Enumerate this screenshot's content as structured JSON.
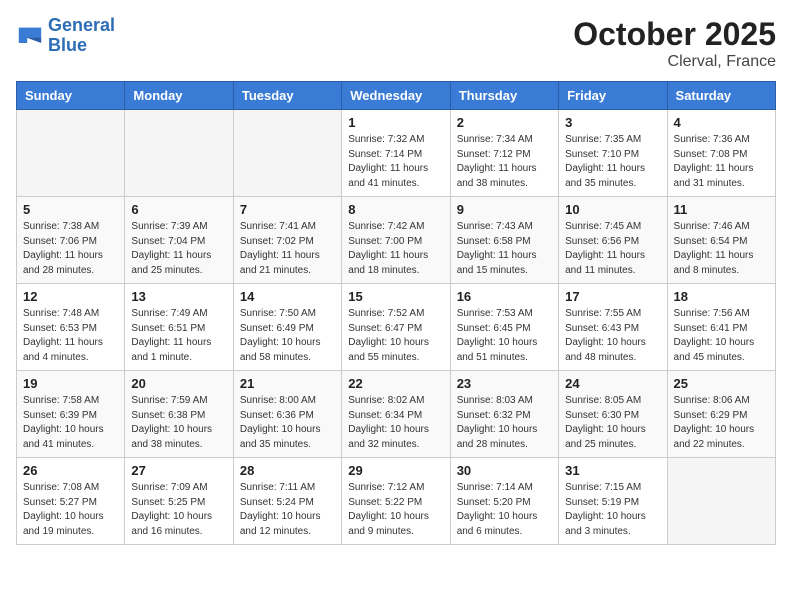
{
  "logo": {
    "line1": "General",
    "line2": "Blue"
  },
  "title": "October 2025",
  "location": "Clerval, France",
  "days_header": [
    "Sunday",
    "Monday",
    "Tuesday",
    "Wednesday",
    "Thursday",
    "Friday",
    "Saturday"
  ],
  "weeks": [
    [
      {
        "day": "",
        "sunrise": "",
        "sunset": "",
        "daylight": ""
      },
      {
        "day": "",
        "sunrise": "",
        "sunset": "",
        "daylight": ""
      },
      {
        "day": "",
        "sunrise": "",
        "sunset": "",
        "daylight": ""
      },
      {
        "day": "1",
        "sunrise": "Sunrise: 7:32 AM",
        "sunset": "Sunset: 7:14 PM",
        "daylight": "Daylight: 11 hours and 41 minutes."
      },
      {
        "day": "2",
        "sunrise": "Sunrise: 7:34 AM",
        "sunset": "Sunset: 7:12 PM",
        "daylight": "Daylight: 11 hours and 38 minutes."
      },
      {
        "day": "3",
        "sunrise": "Sunrise: 7:35 AM",
        "sunset": "Sunset: 7:10 PM",
        "daylight": "Daylight: 11 hours and 35 minutes."
      },
      {
        "day": "4",
        "sunrise": "Sunrise: 7:36 AM",
        "sunset": "Sunset: 7:08 PM",
        "daylight": "Daylight: 11 hours and 31 minutes."
      }
    ],
    [
      {
        "day": "5",
        "sunrise": "Sunrise: 7:38 AM",
        "sunset": "Sunset: 7:06 PM",
        "daylight": "Daylight: 11 hours and 28 minutes."
      },
      {
        "day": "6",
        "sunrise": "Sunrise: 7:39 AM",
        "sunset": "Sunset: 7:04 PM",
        "daylight": "Daylight: 11 hours and 25 minutes."
      },
      {
        "day": "7",
        "sunrise": "Sunrise: 7:41 AM",
        "sunset": "Sunset: 7:02 PM",
        "daylight": "Daylight: 11 hours and 21 minutes."
      },
      {
        "day": "8",
        "sunrise": "Sunrise: 7:42 AM",
        "sunset": "Sunset: 7:00 PM",
        "daylight": "Daylight: 11 hours and 18 minutes."
      },
      {
        "day": "9",
        "sunrise": "Sunrise: 7:43 AM",
        "sunset": "Sunset: 6:58 PM",
        "daylight": "Daylight: 11 hours and 15 minutes."
      },
      {
        "day": "10",
        "sunrise": "Sunrise: 7:45 AM",
        "sunset": "Sunset: 6:56 PM",
        "daylight": "Daylight: 11 hours and 11 minutes."
      },
      {
        "day": "11",
        "sunrise": "Sunrise: 7:46 AM",
        "sunset": "Sunset: 6:54 PM",
        "daylight": "Daylight: 11 hours and 8 minutes."
      }
    ],
    [
      {
        "day": "12",
        "sunrise": "Sunrise: 7:48 AM",
        "sunset": "Sunset: 6:53 PM",
        "daylight": "Daylight: 11 hours and 4 minutes."
      },
      {
        "day": "13",
        "sunrise": "Sunrise: 7:49 AM",
        "sunset": "Sunset: 6:51 PM",
        "daylight": "Daylight: 11 hours and 1 minute."
      },
      {
        "day": "14",
        "sunrise": "Sunrise: 7:50 AM",
        "sunset": "Sunset: 6:49 PM",
        "daylight": "Daylight: 10 hours and 58 minutes."
      },
      {
        "day": "15",
        "sunrise": "Sunrise: 7:52 AM",
        "sunset": "Sunset: 6:47 PM",
        "daylight": "Daylight: 10 hours and 55 minutes."
      },
      {
        "day": "16",
        "sunrise": "Sunrise: 7:53 AM",
        "sunset": "Sunset: 6:45 PM",
        "daylight": "Daylight: 10 hours and 51 minutes."
      },
      {
        "day": "17",
        "sunrise": "Sunrise: 7:55 AM",
        "sunset": "Sunset: 6:43 PM",
        "daylight": "Daylight: 10 hours and 48 minutes."
      },
      {
        "day": "18",
        "sunrise": "Sunrise: 7:56 AM",
        "sunset": "Sunset: 6:41 PM",
        "daylight": "Daylight: 10 hours and 45 minutes."
      }
    ],
    [
      {
        "day": "19",
        "sunrise": "Sunrise: 7:58 AM",
        "sunset": "Sunset: 6:39 PM",
        "daylight": "Daylight: 10 hours and 41 minutes."
      },
      {
        "day": "20",
        "sunrise": "Sunrise: 7:59 AM",
        "sunset": "Sunset: 6:38 PM",
        "daylight": "Daylight: 10 hours and 38 minutes."
      },
      {
        "day": "21",
        "sunrise": "Sunrise: 8:00 AM",
        "sunset": "Sunset: 6:36 PM",
        "daylight": "Daylight: 10 hours and 35 minutes."
      },
      {
        "day": "22",
        "sunrise": "Sunrise: 8:02 AM",
        "sunset": "Sunset: 6:34 PM",
        "daylight": "Daylight: 10 hours and 32 minutes."
      },
      {
        "day": "23",
        "sunrise": "Sunrise: 8:03 AM",
        "sunset": "Sunset: 6:32 PM",
        "daylight": "Daylight: 10 hours and 28 minutes."
      },
      {
        "day": "24",
        "sunrise": "Sunrise: 8:05 AM",
        "sunset": "Sunset: 6:30 PM",
        "daylight": "Daylight: 10 hours and 25 minutes."
      },
      {
        "day": "25",
        "sunrise": "Sunrise: 8:06 AM",
        "sunset": "Sunset: 6:29 PM",
        "daylight": "Daylight: 10 hours and 22 minutes."
      }
    ],
    [
      {
        "day": "26",
        "sunrise": "Sunrise: 7:08 AM",
        "sunset": "Sunset: 5:27 PM",
        "daylight": "Daylight: 10 hours and 19 minutes."
      },
      {
        "day": "27",
        "sunrise": "Sunrise: 7:09 AM",
        "sunset": "Sunset: 5:25 PM",
        "daylight": "Daylight: 10 hours and 16 minutes."
      },
      {
        "day": "28",
        "sunrise": "Sunrise: 7:11 AM",
        "sunset": "Sunset: 5:24 PM",
        "daylight": "Daylight: 10 hours and 12 minutes."
      },
      {
        "day": "29",
        "sunrise": "Sunrise: 7:12 AM",
        "sunset": "Sunset: 5:22 PM",
        "daylight": "Daylight: 10 hours and 9 minutes."
      },
      {
        "day": "30",
        "sunrise": "Sunrise: 7:14 AM",
        "sunset": "Sunset: 5:20 PM",
        "daylight": "Daylight: 10 hours and 6 minutes."
      },
      {
        "day": "31",
        "sunrise": "Sunrise: 7:15 AM",
        "sunset": "Sunset: 5:19 PM",
        "daylight": "Daylight: 10 hours and 3 minutes."
      },
      {
        "day": "",
        "sunrise": "",
        "sunset": "",
        "daylight": ""
      }
    ]
  ]
}
